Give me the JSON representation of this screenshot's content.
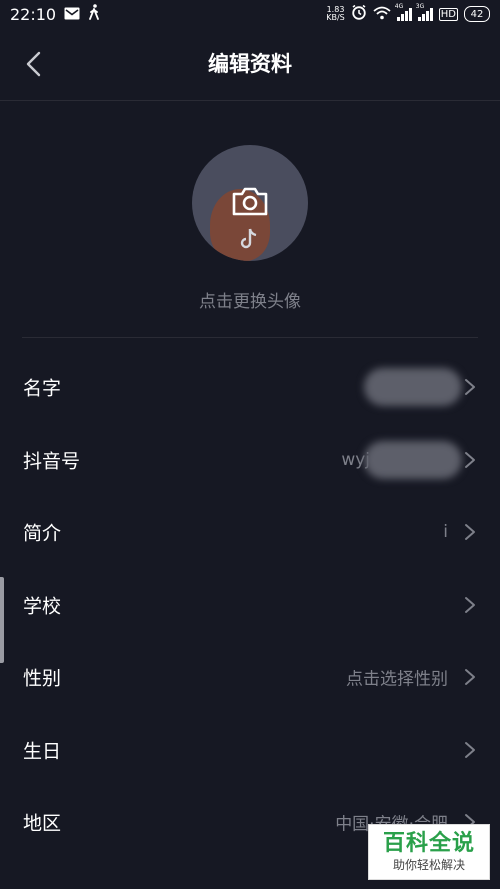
{
  "status_bar": {
    "time": "22:10",
    "net_speed_value": "1.83",
    "net_speed_unit": "KB/S",
    "signal1_tag": "4G",
    "signal2_tag": "3G",
    "hd_label": "HD",
    "battery": "42"
  },
  "nav": {
    "title": "编辑资料"
  },
  "avatar": {
    "caption": "点击更换头像"
  },
  "fields": [
    {
      "label": "名字",
      "value": ""
    },
    {
      "label": "抖音号",
      "value": "wyj"
    },
    {
      "label": "简介",
      "value": "i"
    },
    {
      "label": "学校",
      "value": ""
    },
    {
      "label": "性别",
      "value": "点击选择性别"
    },
    {
      "label": "生日",
      "value": ""
    },
    {
      "label": "地区",
      "value": "中国·安徽·合肥"
    }
  ],
  "watermark": {
    "main": "百科全说",
    "sub": "助你轻松解决"
  },
  "colors": {
    "background": "#161823",
    "label": "#ffffff",
    "secondary_text": "#7e808a",
    "divider": "#2a2b35",
    "watermark_green": "#2aa04a"
  }
}
